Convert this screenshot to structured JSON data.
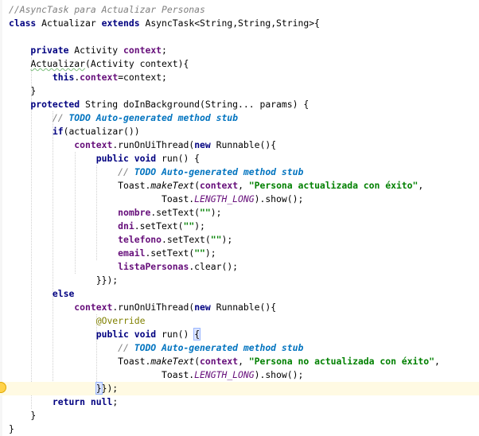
{
  "lines": [
    [
      {
        "t": "//AsyncTask para Actualizar Personas",
        "c": "cmt"
      }
    ],
    [
      {
        "t": "class ",
        "c": "kw"
      },
      {
        "t": "Actualizar ",
        "c": ""
      },
      {
        "t": "extends ",
        "c": "kw"
      },
      {
        "t": "AsyncTask<String,String,String>{",
        "c": ""
      }
    ],
    [],
    [
      {
        "t": "    private ",
        "c": "kw"
      },
      {
        "t": "Activity ",
        "c": ""
      },
      {
        "t": "context",
        "c": "field"
      },
      {
        "t": ";",
        "c": ""
      }
    ],
    [
      {
        "t": "    ",
        "c": ""
      },
      {
        "t": "Actualizar",
        "c": "squig"
      },
      {
        "t": "(Activity context){",
        "c": ""
      }
    ],
    [
      {
        "t": "        ",
        "c": ""
      },
      {
        "t": "this",
        "c": "kw"
      },
      {
        "t": ".",
        "c": ""
      },
      {
        "t": "context",
        "c": "field"
      },
      {
        "t": "=context;",
        "c": ""
      }
    ],
    [
      {
        "t": "    }",
        "c": ""
      }
    ],
    [
      {
        "t": "    protected ",
        "c": "kw"
      },
      {
        "t": "String doInBackground(String... params) {",
        "c": ""
      }
    ],
    [
      {
        "t": "        // ",
        "c": "cmt"
      },
      {
        "t": "TODO Auto-generated method stub",
        "c": "todo"
      }
    ],
    [
      {
        "t": "        ",
        "c": ""
      },
      {
        "t": "if",
        "c": "kw"
      },
      {
        "t": "(actualizar())",
        "c": ""
      }
    ],
    [
      {
        "t": "            ",
        "c": ""
      },
      {
        "t": "context",
        "c": "field"
      },
      {
        "t": ".runOnUiThread(",
        "c": ""
      },
      {
        "t": "new ",
        "c": "kw"
      },
      {
        "t": "Runnable(){",
        "c": ""
      }
    ],
    [
      {
        "t": "                ",
        "c": ""
      },
      {
        "t": "public void ",
        "c": "kw"
      },
      {
        "t": "run() {",
        "c": ""
      }
    ],
    [
      {
        "t": "                    // ",
        "c": "cmt"
      },
      {
        "t": "TODO Auto-generated method stub",
        "c": "todo"
      }
    ],
    [
      {
        "t": "                    Toast.",
        "c": ""
      },
      {
        "t": "makeText",
        "c": "mcall"
      },
      {
        "t": "(",
        "c": ""
      },
      {
        "t": "context",
        "c": "field"
      },
      {
        "t": ", ",
        "c": ""
      },
      {
        "t": "\"Persona actualizada con éxito\"",
        "c": "str"
      },
      {
        "t": ",",
        "c": ""
      }
    ],
    [
      {
        "t": "                            Toast.",
        "c": ""
      },
      {
        "t": "LENGTH_LONG",
        "c": "static"
      },
      {
        "t": ").show();",
        "c": ""
      }
    ],
    [
      {
        "t": "                    ",
        "c": ""
      },
      {
        "t": "nombre",
        "c": "field"
      },
      {
        "t": ".setText(",
        "c": ""
      },
      {
        "t": "\"\"",
        "c": "str"
      },
      {
        "t": ");",
        "c": ""
      }
    ],
    [
      {
        "t": "                    ",
        "c": ""
      },
      {
        "t": "dni",
        "c": "field"
      },
      {
        "t": ".setText(",
        "c": ""
      },
      {
        "t": "\"\"",
        "c": "str"
      },
      {
        "t": ");",
        "c": ""
      }
    ],
    [
      {
        "t": "                    ",
        "c": ""
      },
      {
        "t": "telefono",
        "c": "field"
      },
      {
        "t": ".setText(",
        "c": ""
      },
      {
        "t": "\"\"",
        "c": "str"
      },
      {
        "t": ");",
        "c": ""
      }
    ],
    [
      {
        "t": "                    ",
        "c": ""
      },
      {
        "t": "email",
        "c": "field"
      },
      {
        "t": ".setText(",
        "c": ""
      },
      {
        "t": "\"\"",
        "c": "str"
      },
      {
        "t": ");",
        "c": ""
      }
    ],
    [
      {
        "t": "                    ",
        "c": ""
      },
      {
        "t": "listaPersonas",
        "c": "field"
      },
      {
        "t": ".clear();",
        "c": ""
      }
    ],
    [
      {
        "t": "                }});",
        "c": ""
      }
    ],
    [
      {
        "t": "        ",
        "c": ""
      },
      {
        "t": "else",
        "c": "kw"
      }
    ],
    [
      {
        "t": "            ",
        "c": ""
      },
      {
        "t": "context",
        "c": "field"
      },
      {
        "t": ".runOnUiThread(",
        "c": ""
      },
      {
        "t": "new ",
        "c": "kw"
      },
      {
        "t": "Runnable(){",
        "c": ""
      }
    ],
    [
      {
        "t": "                ",
        "c": ""
      },
      {
        "t": "@Override",
        "c": "anno"
      }
    ],
    [
      {
        "t": "                ",
        "c": ""
      },
      {
        "t": "public void ",
        "c": "kw"
      },
      {
        "t": "run() ",
        "c": ""
      },
      {
        "t": "{",
        "c": "brace-hl"
      }
    ],
    [
      {
        "t": "                    // ",
        "c": "cmt"
      },
      {
        "t": "TODO Auto-generated method stub",
        "c": "todo"
      }
    ],
    [
      {
        "t": "                    Toast.",
        "c": ""
      },
      {
        "t": "makeText",
        "c": "mcall"
      },
      {
        "t": "(",
        "c": ""
      },
      {
        "t": "context",
        "c": "field"
      },
      {
        "t": ", ",
        "c": ""
      },
      {
        "t": "\"Persona no actualizada con éxito\"",
        "c": "str"
      },
      {
        "t": ",",
        "c": ""
      }
    ],
    [
      {
        "t": "                            Toast.",
        "c": ""
      },
      {
        "t": "LENGTH_LONG",
        "c": "static"
      },
      {
        "t": ").show();",
        "c": ""
      }
    ],
    [
      {
        "t": "                ",
        "c": ""
      },
      {
        "t": "}",
        "c": "brace-hl"
      },
      {
        "t": "});",
        "c": ""
      }
    ],
    [
      {
        "t": "        ",
        "c": ""
      },
      {
        "t": "return null",
        "c": "kw"
      },
      {
        "t": ";",
        "c": ""
      }
    ],
    [
      {
        "t": "    }",
        "c": ""
      }
    ],
    [
      {
        "t": "}",
        "c": ""
      }
    ]
  ],
  "current_line": 28,
  "lightbulb": "intention-bulb-icon",
  "colors": {
    "keyword": "#000080",
    "field": "#660e7a",
    "string": "#008000",
    "comment": "#808080",
    "todo": "#0073bf",
    "annotation": "#808000",
    "current_line_bg": "#fffae3"
  }
}
